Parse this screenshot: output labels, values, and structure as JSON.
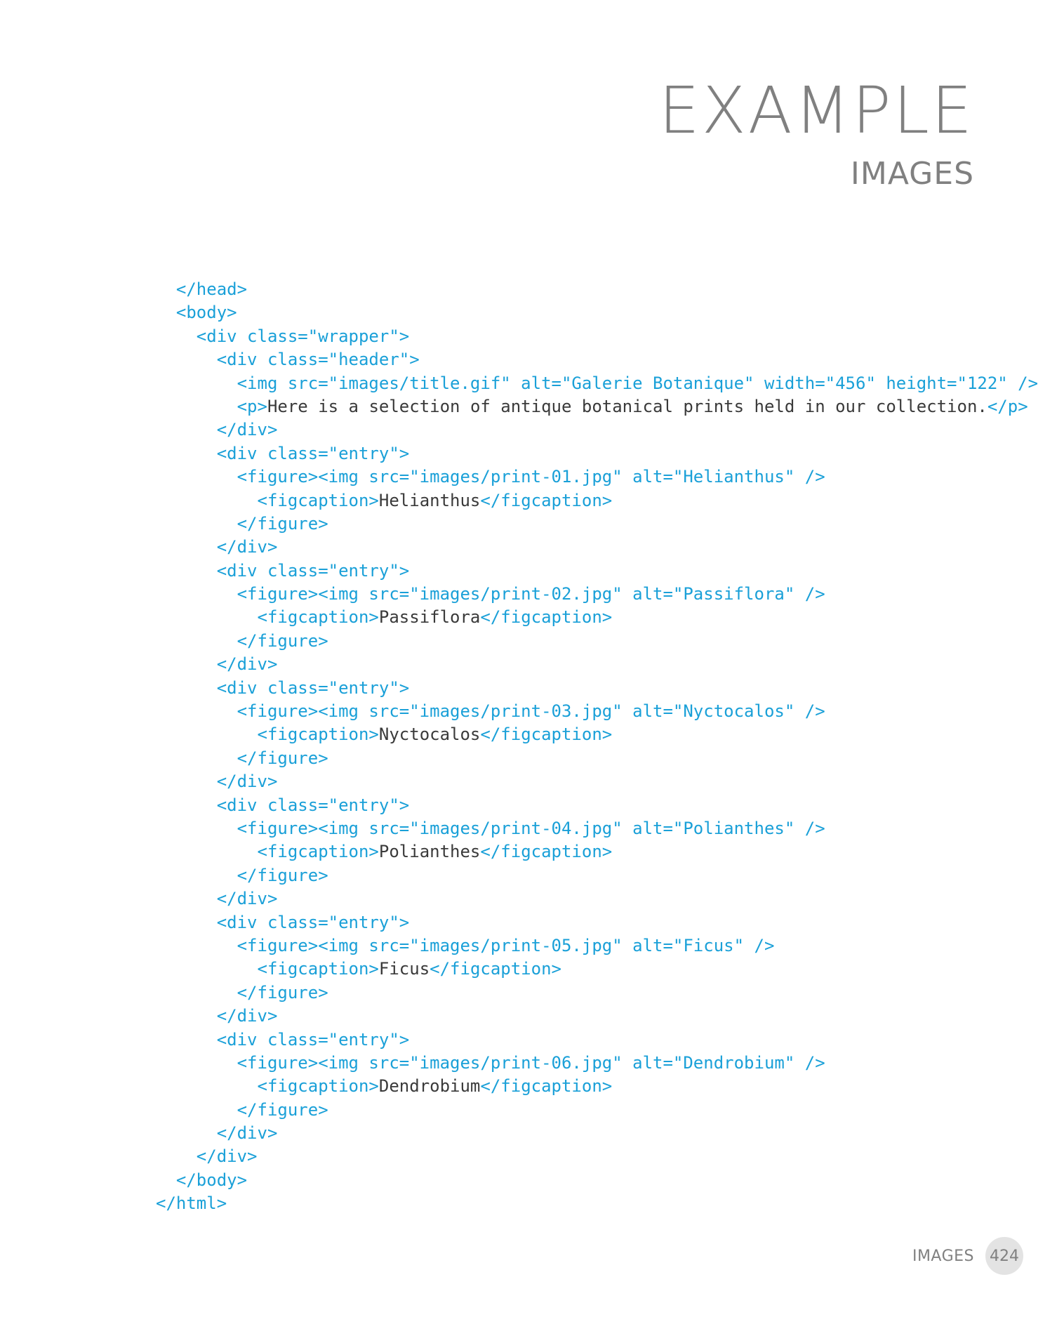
{
  "heading": {
    "title": "EXAMPLE",
    "subtitle": "IMAGES"
  },
  "code": {
    "lines": [
      [
        {
          "t": "  </head>",
          "k": "tag"
        }
      ],
      [
        {
          "t": "  <body>",
          "k": "tag"
        }
      ],
      [
        {
          "t": "    <div class=\"wrapper\">",
          "k": "tag"
        }
      ],
      [
        {
          "t": "      <div class=\"header\">",
          "k": "tag"
        }
      ],
      [
        {
          "t": "        <img src=\"images/title.gif\" alt=\"Galerie Botanique\" width=\"456\" height=\"122\" />",
          "k": "tag"
        }
      ],
      [
        {
          "t": "        <p>",
          "k": "tag"
        },
        {
          "t": "Here is a selection of antique botanical prints held in our collection.",
          "k": "text"
        },
        {
          "t": "</p>",
          "k": "tag"
        }
      ],
      [
        {
          "t": "      </div>",
          "k": "tag"
        }
      ],
      [
        {
          "t": "      <div class=\"entry\">",
          "k": "tag"
        }
      ],
      [
        {
          "t": "        <figure><img src=\"images/print-01.jpg\" alt=\"Helianthus\" />",
          "k": "tag"
        }
      ],
      [
        {
          "t": "          <figcaption>",
          "k": "tag"
        },
        {
          "t": "Helianthus",
          "k": "text"
        },
        {
          "t": "</figcaption>",
          "k": "tag"
        }
      ],
      [
        {
          "t": "        </figure>",
          "k": "tag"
        }
      ],
      [
        {
          "t": "      </div>",
          "k": "tag"
        }
      ],
      [
        {
          "t": "      <div class=\"entry\">",
          "k": "tag"
        }
      ],
      [
        {
          "t": "        <figure><img src=\"images/print-02.jpg\" alt=\"Passiflora\" />",
          "k": "tag"
        }
      ],
      [
        {
          "t": "          <figcaption>",
          "k": "tag"
        },
        {
          "t": "Passiflora",
          "k": "text"
        },
        {
          "t": "</figcaption>",
          "k": "tag"
        }
      ],
      [
        {
          "t": "        </figure>",
          "k": "tag"
        }
      ],
      [
        {
          "t": "      </div>",
          "k": "tag"
        }
      ],
      [
        {
          "t": "      <div class=\"entry\">",
          "k": "tag"
        }
      ],
      [
        {
          "t": "        <figure><img src=\"images/print-03.jpg\" alt=\"Nyctocalos\" />",
          "k": "tag"
        }
      ],
      [
        {
          "t": "          <figcaption>",
          "k": "tag"
        },
        {
          "t": "Nyctocalos",
          "k": "text"
        },
        {
          "t": "</figcaption>",
          "k": "tag"
        }
      ],
      [
        {
          "t": "        </figure>",
          "k": "tag"
        }
      ],
      [
        {
          "t": "      </div>",
          "k": "tag"
        }
      ],
      [
        {
          "t": "      <div class=\"entry\">",
          "k": "tag"
        }
      ],
      [
        {
          "t": "        <figure><img src=\"images/print-04.jpg\" alt=\"Polianthes\" />",
          "k": "tag"
        }
      ],
      [
        {
          "t": "          <figcaption>",
          "k": "tag"
        },
        {
          "t": "Polianthes",
          "k": "text"
        },
        {
          "t": "</figcaption>",
          "k": "tag"
        }
      ],
      [
        {
          "t": "        </figure>",
          "k": "tag"
        }
      ],
      [
        {
          "t": "      </div>",
          "k": "tag"
        }
      ],
      [
        {
          "t": "      <div class=\"entry\">",
          "k": "tag"
        }
      ],
      [
        {
          "t": "        <figure><img src=\"images/print-05.jpg\" alt=\"Ficus\" />",
          "k": "tag"
        }
      ],
      [
        {
          "t": "          <figcaption>",
          "k": "tag"
        },
        {
          "t": "Ficus",
          "k": "text"
        },
        {
          "t": "</figcaption>",
          "k": "tag"
        }
      ],
      [
        {
          "t": "        </figure>",
          "k": "tag"
        }
      ],
      [
        {
          "t": "      </div>",
          "k": "tag"
        }
      ],
      [
        {
          "t": "      <div class=\"entry\">",
          "k": "tag"
        }
      ],
      [
        {
          "t": "        <figure><img src=\"images/print-06.jpg\" alt=\"Dendrobium\" />",
          "k": "tag"
        }
      ],
      [
        {
          "t": "          <figcaption>",
          "k": "tag"
        },
        {
          "t": "Dendrobium",
          "k": "text"
        },
        {
          "t": "</figcaption>",
          "k": "tag"
        }
      ],
      [
        {
          "t": "        </figure>",
          "k": "tag"
        }
      ],
      [
        {
          "t": "      </div>",
          "k": "tag"
        }
      ],
      [
        {
          "t": "    </div>",
          "k": "tag"
        }
      ],
      [
        {
          "t": "  </body>",
          "k": "tag"
        }
      ],
      [
        {
          "t": "</html>",
          "k": "tag"
        }
      ]
    ]
  },
  "colors": {
    "heading": "#808080",
    "code_tag": "#1aa0d8",
    "code_text": "#3a3a3a",
    "page_badge": "#e3e3e3"
  },
  "footer": {
    "section": "IMAGES",
    "page_number": "424"
  }
}
